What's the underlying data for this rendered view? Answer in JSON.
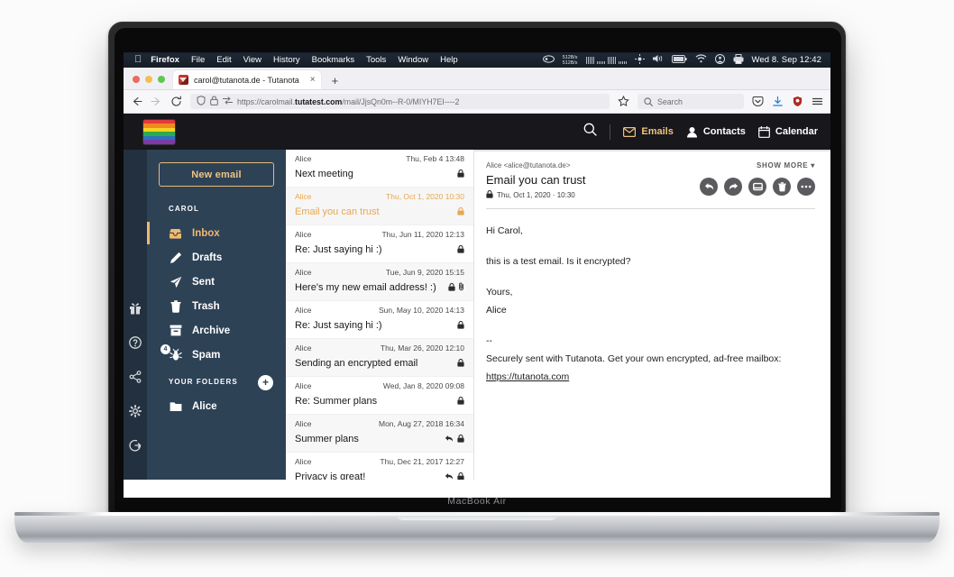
{
  "device": {
    "model_label": "MacBook Air"
  },
  "menubar": {
    "apple": "apple-logo",
    "items": [
      "Firefox",
      "File",
      "Edit",
      "View",
      "History",
      "Bookmarks",
      "Tools",
      "Window",
      "Help"
    ],
    "net_up": "512B/s",
    "net_down": "512B/s",
    "clock": "Wed 8. Sep  12:42"
  },
  "browser": {
    "tab": {
      "title": "carol@tutanota.de - Tutanota",
      "close": "×"
    },
    "new_tab": "+",
    "url": {
      "scheme": "https://carolmail.",
      "host": "tutatest.com",
      "path": "/mail/JjsQn0m--R-0/MIYH7EI----2"
    },
    "search_placeholder": "Search"
  },
  "app": {
    "nav": [
      {
        "label": "Emails",
        "icon": "mail-icon",
        "active": true
      },
      {
        "label": "Contacts",
        "icon": "person-icon",
        "active": false
      },
      {
        "label": "Calendar",
        "icon": "calendar-icon",
        "active": false
      }
    ],
    "logo_colors": [
      "#e03b3b",
      "#f08a1e",
      "#f3d424",
      "#2eab4b",
      "#2f6fc4",
      "#7c3aa8"
    ],
    "accent_color": "#efb96f",
    "sidebar_color": "#2e4256",
    "header_color": "#17171c",
    "sidebar": {
      "new_email": "New email",
      "account_label": "CAROL",
      "folders": [
        {
          "label": "Inbox",
          "icon": "inbox-icon",
          "active": true,
          "badge": ""
        },
        {
          "label": "Drafts",
          "icon": "pencil-icon",
          "active": false,
          "badge": ""
        },
        {
          "label": "Sent",
          "icon": "send-icon",
          "active": false,
          "badge": ""
        },
        {
          "label": "Trash",
          "icon": "trash-icon",
          "active": false,
          "badge": ""
        },
        {
          "label": "Archive",
          "icon": "archive-icon",
          "active": false,
          "badge": ""
        },
        {
          "label": "Spam",
          "icon": "bug-icon",
          "active": false,
          "badge": "4"
        }
      ],
      "your_folders_label": "YOUR FOLDERS",
      "add_folder": "+",
      "user_folders": [
        {
          "label": "Alice",
          "icon": "folder-icon"
        }
      ]
    },
    "rail": [
      "gift-icon",
      "help-icon",
      "share-icon",
      "settings-icon",
      "logout-icon"
    ],
    "maillist": [
      {
        "sender": "Alice",
        "date": "Thu, Feb 4 13:48",
        "subject": "Next meeting",
        "locked": true,
        "replied": false,
        "attachment": false,
        "selected": false
      },
      {
        "sender": "Alice",
        "date": "Thu, Oct 1, 2020 10:30",
        "subject": "Email you can trust",
        "locked": true,
        "replied": false,
        "attachment": false,
        "selected": true
      },
      {
        "sender": "Alice",
        "date": "Thu, Jun 11, 2020 12:13",
        "subject": "Re: Just saying hi :)",
        "locked": true,
        "replied": false,
        "attachment": false,
        "selected": false
      },
      {
        "sender": "Alice",
        "date": "Tue, Jun 9, 2020 15:15",
        "subject": "Here's my new email address! :)",
        "locked": true,
        "replied": false,
        "attachment": true,
        "selected": false
      },
      {
        "sender": "Alice",
        "date": "Sun, May 10, 2020 14:13",
        "subject": "Re: Just saying hi :)",
        "locked": true,
        "replied": false,
        "attachment": false,
        "selected": false
      },
      {
        "sender": "Alice",
        "date": "Thu, Mar 26, 2020 12:10",
        "subject": "Sending an encrypted email",
        "locked": true,
        "replied": false,
        "attachment": false,
        "selected": false
      },
      {
        "sender": "Alice",
        "date": "Wed, Jan 8, 2020 09:08",
        "subject": "Re: Summer plans",
        "locked": true,
        "replied": false,
        "attachment": false,
        "selected": false
      },
      {
        "sender": "Alice",
        "date": "Mon, Aug 27, 2018 16:34",
        "subject": "Summer plans",
        "locked": true,
        "replied": true,
        "attachment": false,
        "selected": false
      },
      {
        "sender": "Alice",
        "date": "Thu, Dec 21, 2017 12:27",
        "subject": "Privacy is great!",
        "locked": true,
        "replied": true,
        "attachment": false,
        "selected": false
      }
    ],
    "detail": {
      "from": "Alice <alice@tutanota.de>",
      "subject": "Email you can trust",
      "date": "Thu, Oct 1, 2020 · 10:30",
      "show_more": "SHOW MORE",
      "actions": [
        "reply-icon",
        "forward-icon",
        "move-icon",
        "delete-icon",
        "more-icon"
      ],
      "body": {
        "greeting": "Hi Carol,",
        "line1": "this is a test email. Is it encrypted?",
        "closing": "Yours,",
        "signer": "Alice",
        "sep": "--",
        "footer": "Securely sent with Tutanota. Get your own encrypted, ad-free mailbox:",
        "link": "https://tutanota.com"
      }
    }
  }
}
